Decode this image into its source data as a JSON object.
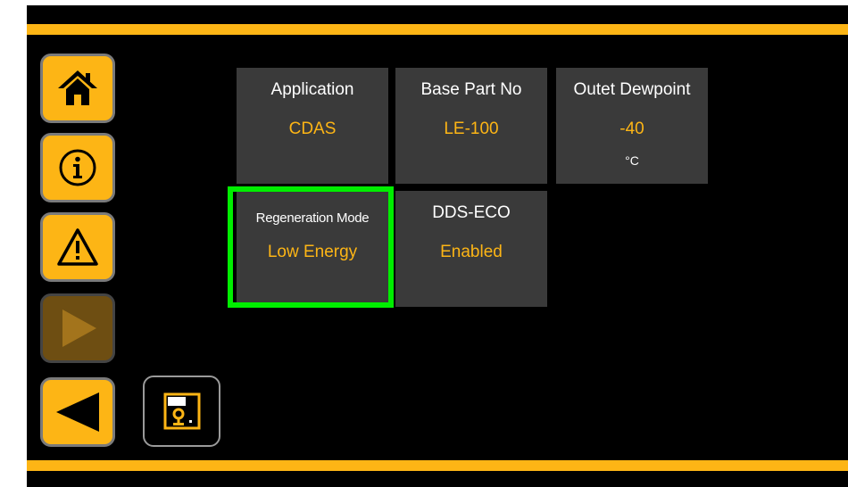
{
  "colors": {
    "accent": "#FDB515",
    "tile_bg": "#3a3a3a",
    "selection": "#00ee00",
    "value_text": "#FDB515"
  },
  "nav": [
    {
      "name": "home-button",
      "icon": "home-icon",
      "enabled": true
    },
    {
      "name": "info-button",
      "icon": "info-icon",
      "enabled": true
    },
    {
      "name": "alarm-button",
      "icon": "warning-icon",
      "enabled": true
    },
    {
      "name": "play-button",
      "icon": "play-icon",
      "enabled": false
    },
    {
      "name": "back-button",
      "icon": "back-arrow-icon",
      "enabled": true
    }
  ],
  "save_button": {
    "icon": "save-icon"
  },
  "tiles": [
    {
      "label": "Application",
      "value": "CDAS"
    },
    {
      "label": "Base Part No",
      "value": "LE-100"
    },
    {
      "label": "Outet Dewpoint",
      "value": "-40",
      "unit": "°C"
    },
    {
      "label": "Regeneration Mode",
      "value": "Low Energy",
      "selected": true
    },
    {
      "label": "DDS-ECO",
      "value": "Enabled"
    }
  ]
}
